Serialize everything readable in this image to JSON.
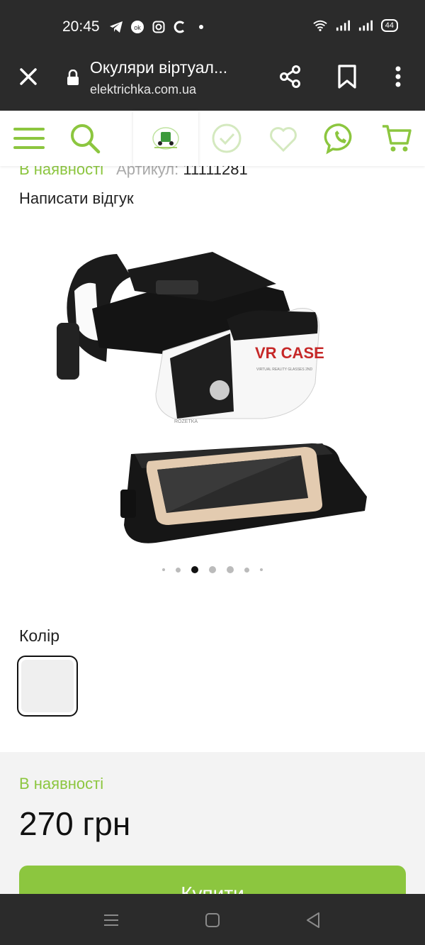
{
  "status_bar": {
    "time": "20:45",
    "left_icons": [
      "telegram-icon",
      "ok-icon",
      "instagram-icon",
      "c-app-icon",
      "dot-icon"
    ],
    "right_icons": [
      "wifi-icon",
      "signal-icon",
      "signal-icon"
    ],
    "battery": "44"
  },
  "browser": {
    "title": "Окуляри віртуал...",
    "url": "elektrichka.com.ua"
  },
  "site_header": {
    "icons": [
      "menu-icon",
      "search-icon",
      "logo",
      "compare-icon",
      "favorites-icon",
      "viber-icon",
      "cart-icon"
    ],
    "accent_color": "#8cc63f"
  },
  "product": {
    "availability": "В наявності",
    "article_label": "Артикул:",
    "article_value": "11111281",
    "review_link": "Написати відгук",
    "image_text": {
      "brand": "VR CASE",
      "tagline": "VIRTUAL REALITY GLASSES 2ND",
      "watermark": "ROZETKA"
    },
    "gallery_dots": {
      "count": 7,
      "active_index": 2
    },
    "color_label": "Колір",
    "color_swatch": "#efefef"
  },
  "purchase": {
    "availability": "В наявності",
    "price": "270 грн",
    "buy_label": "Купити"
  },
  "nav_bar": {
    "buttons": [
      "recent-apps-icon",
      "home-icon",
      "back-icon"
    ]
  }
}
